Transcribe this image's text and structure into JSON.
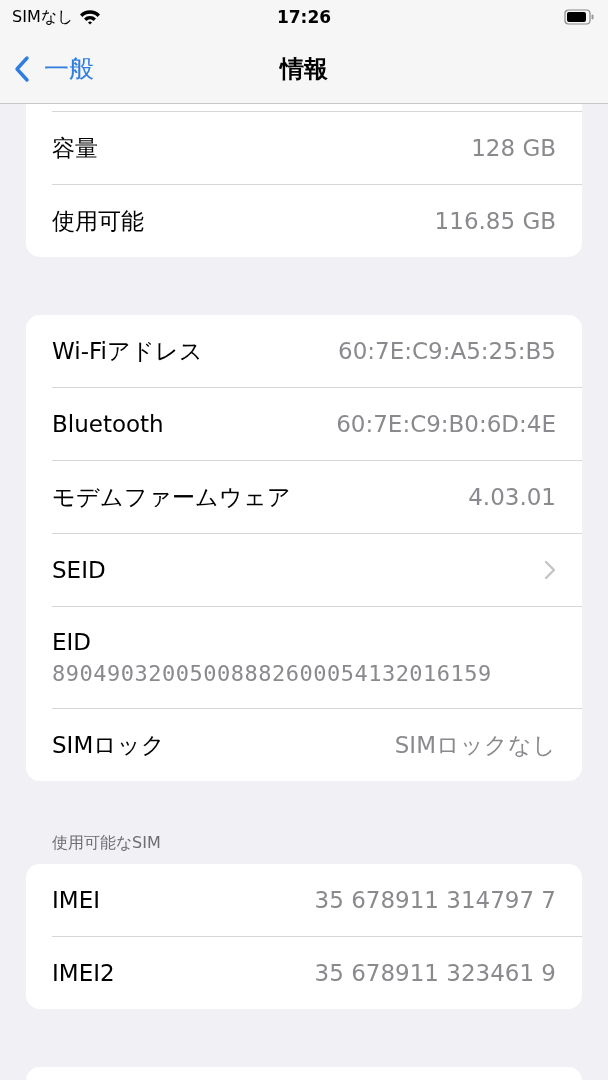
{
  "status_bar": {
    "carrier": "SIMなし",
    "time": "17:26"
  },
  "nav": {
    "back": "一般",
    "title": "情報"
  },
  "groups": [
    {
      "cut_top": true,
      "rows": [
        {
          "kind": "value",
          "label": "容量",
          "value": "128 GB"
        },
        {
          "kind": "value",
          "label": "使用可能",
          "value": "116.85 GB"
        }
      ]
    },
    {
      "rows": [
        {
          "kind": "value",
          "label": "Wi-Fiアドレス",
          "value": "60:7E:C9:A5:25:B5"
        },
        {
          "kind": "value",
          "label": "Bluetooth",
          "value": "60:7E:C9:B0:6D:4E"
        },
        {
          "kind": "value",
          "label": "モデムファームウェア",
          "value": "4.03.01"
        },
        {
          "kind": "chevron",
          "label": "SEID"
        },
        {
          "kind": "stacked",
          "label": "EID",
          "value": "89049032005008882600054132016159"
        },
        {
          "kind": "value",
          "label": "SIMロック",
          "value": "SIMロックなし"
        }
      ]
    },
    {
      "header": "使用可能なSIM",
      "rows": [
        {
          "kind": "value",
          "label": "IMEI",
          "value": "35 678911 314797 7"
        },
        {
          "kind": "value",
          "label": "IMEI2",
          "value": "35 678911 323461 9"
        }
      ]
    }
  ]
}
